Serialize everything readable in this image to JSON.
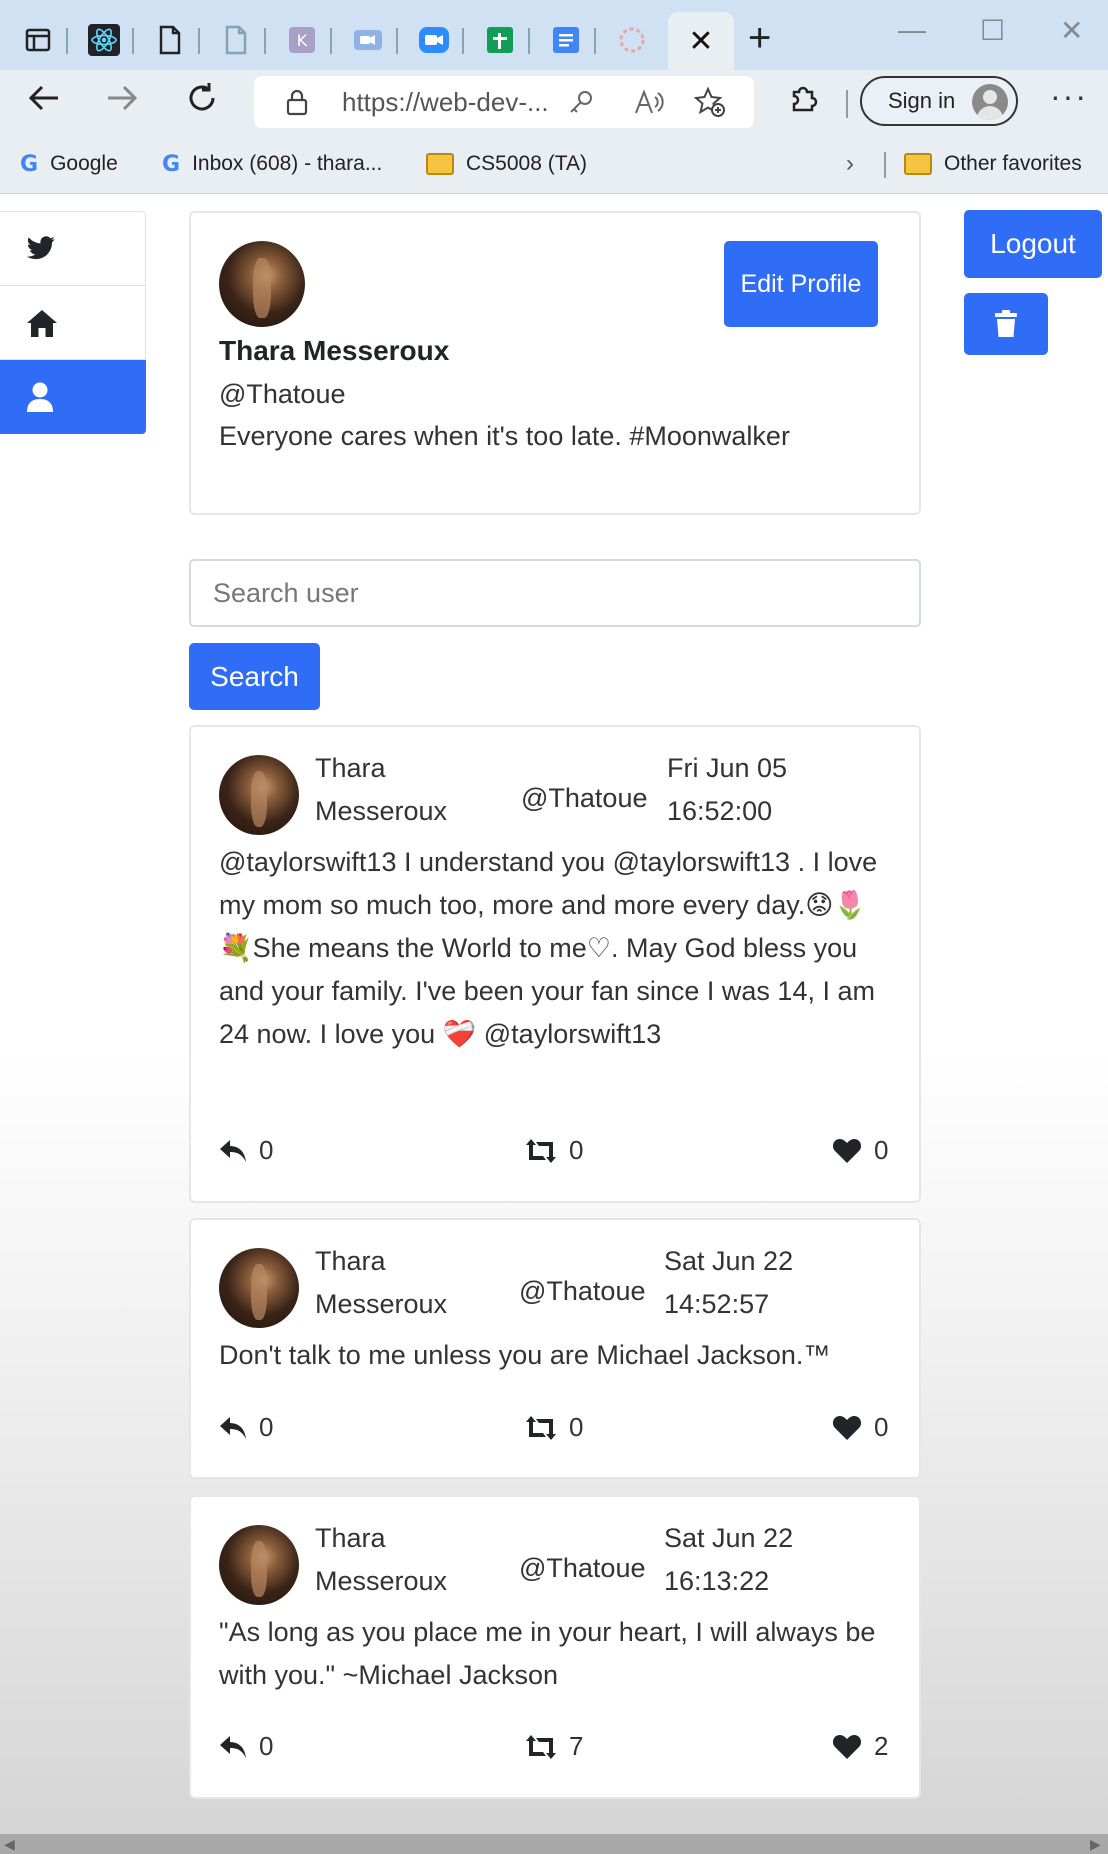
{
  "browser": {
    "tabs": [
      {
        "icon": "window-icon"
      },
      {
        "icon": "react-icon"
      },
      {
        "icon": "page-icon"
      },
      {
        "icon": "page-icon"
      },
      {
        "icon": "app-icon"
      },
      {
        "icon": "video-icon"
      },
      {
        "icon": "zoom-icon"
      },
      {
        "icon": "sheets-icon"
      },
      {
        "icon": "docs-icon"
      },
      {
        "icon": "loading-icon"
      }
    ],
    "active_tab_close": "✕",
    "url": "https://web-dev-...",
    "sign_in_label": "Sign in",
    "bookmarks": [
      {
        "label": "Google",
        "icon": "google-icon"
      },
      {
        "label": "Inbox (608) - thara...",
        "icon": "google-icon"
      },
      {
        "label": "CS5008 (TA)",
        "icon": "folder-icon"
      }
    ],
    "other_favorites": "Other favorites",
    "accent": "#2f6df6"
  },
  "profile": {
    "name": "Thara Messeroux",
    "handle": "@Thatoue",
    "bio": "Everyone cares when it's too late. #Moonwalker",
    "edit_label": "Edit Profile"
  },
  "actions": {
    "logout_label": "Logout"
  },
  "search": {
    "placeholder": "Search user",
    "button_label": "Search"
  },
  "tweets": [
    {
      "name_line1": "Thara",
      "name_line2": "Messeroux",
      "handle": "@Thatoue",
      "date": "Fri Jun 05",
      "time": "16:52:00",
      "text": "@taylorswift13 I understand you @taylorswift13 . I love my mom so much too, more and more every day.😟🌷💐She means the World to me♡. May God bless you and your family. I've been your fan since I was 14, I am 24 now. I love you ❤️‍🩹 @taylorswift13",
      "replies": "0",
      "retweets": "0",
      "likes": "0"
    },
    {
      "name_line1": "Thara",
      "name_line2": "Messeroux",
      "handle": "@Thatoue",
      "date": "Sat Jun 22",
      "time": "14:52:57",
      "text": "Don't talk to me unless you are Michael Jackson.™",
      "replies": "0",
      "retweets": "0",
      "likes": "0"
    },
    {
      "name_line1": "Thara",
      "name_line2": "Messeroux",
      "handle": "@Thatoue",
      "date": "Sat Jun 22",
      "time": "16:13:22",
      "text": "\"As long as you place me in your heart, I will always be with you.\" ~Michael Jackson",
      "replies": "0",
      "retweets": "7",
      "likes": "2"
    }
  ]
}
